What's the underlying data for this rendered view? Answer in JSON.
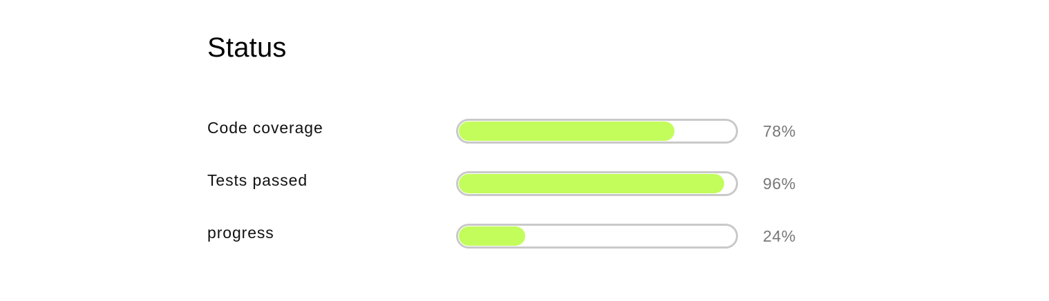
{
  "status": {
    "title": "Status",
    "accent_color": "#c2fd5b",
    "track_border_color": "#c9c9c9",
    "metrics": [
      {
        "label": "Code coverage",
        "value_text": "78%",
        "percent": 78
      },
      {
        "label": "Tests passed",
        "value_text": "96%",
        "percent": 96
      },
      {
        "label": "progress",
        "value_text": "24%",
        "percent": 24
      }
    ]
  }
}
